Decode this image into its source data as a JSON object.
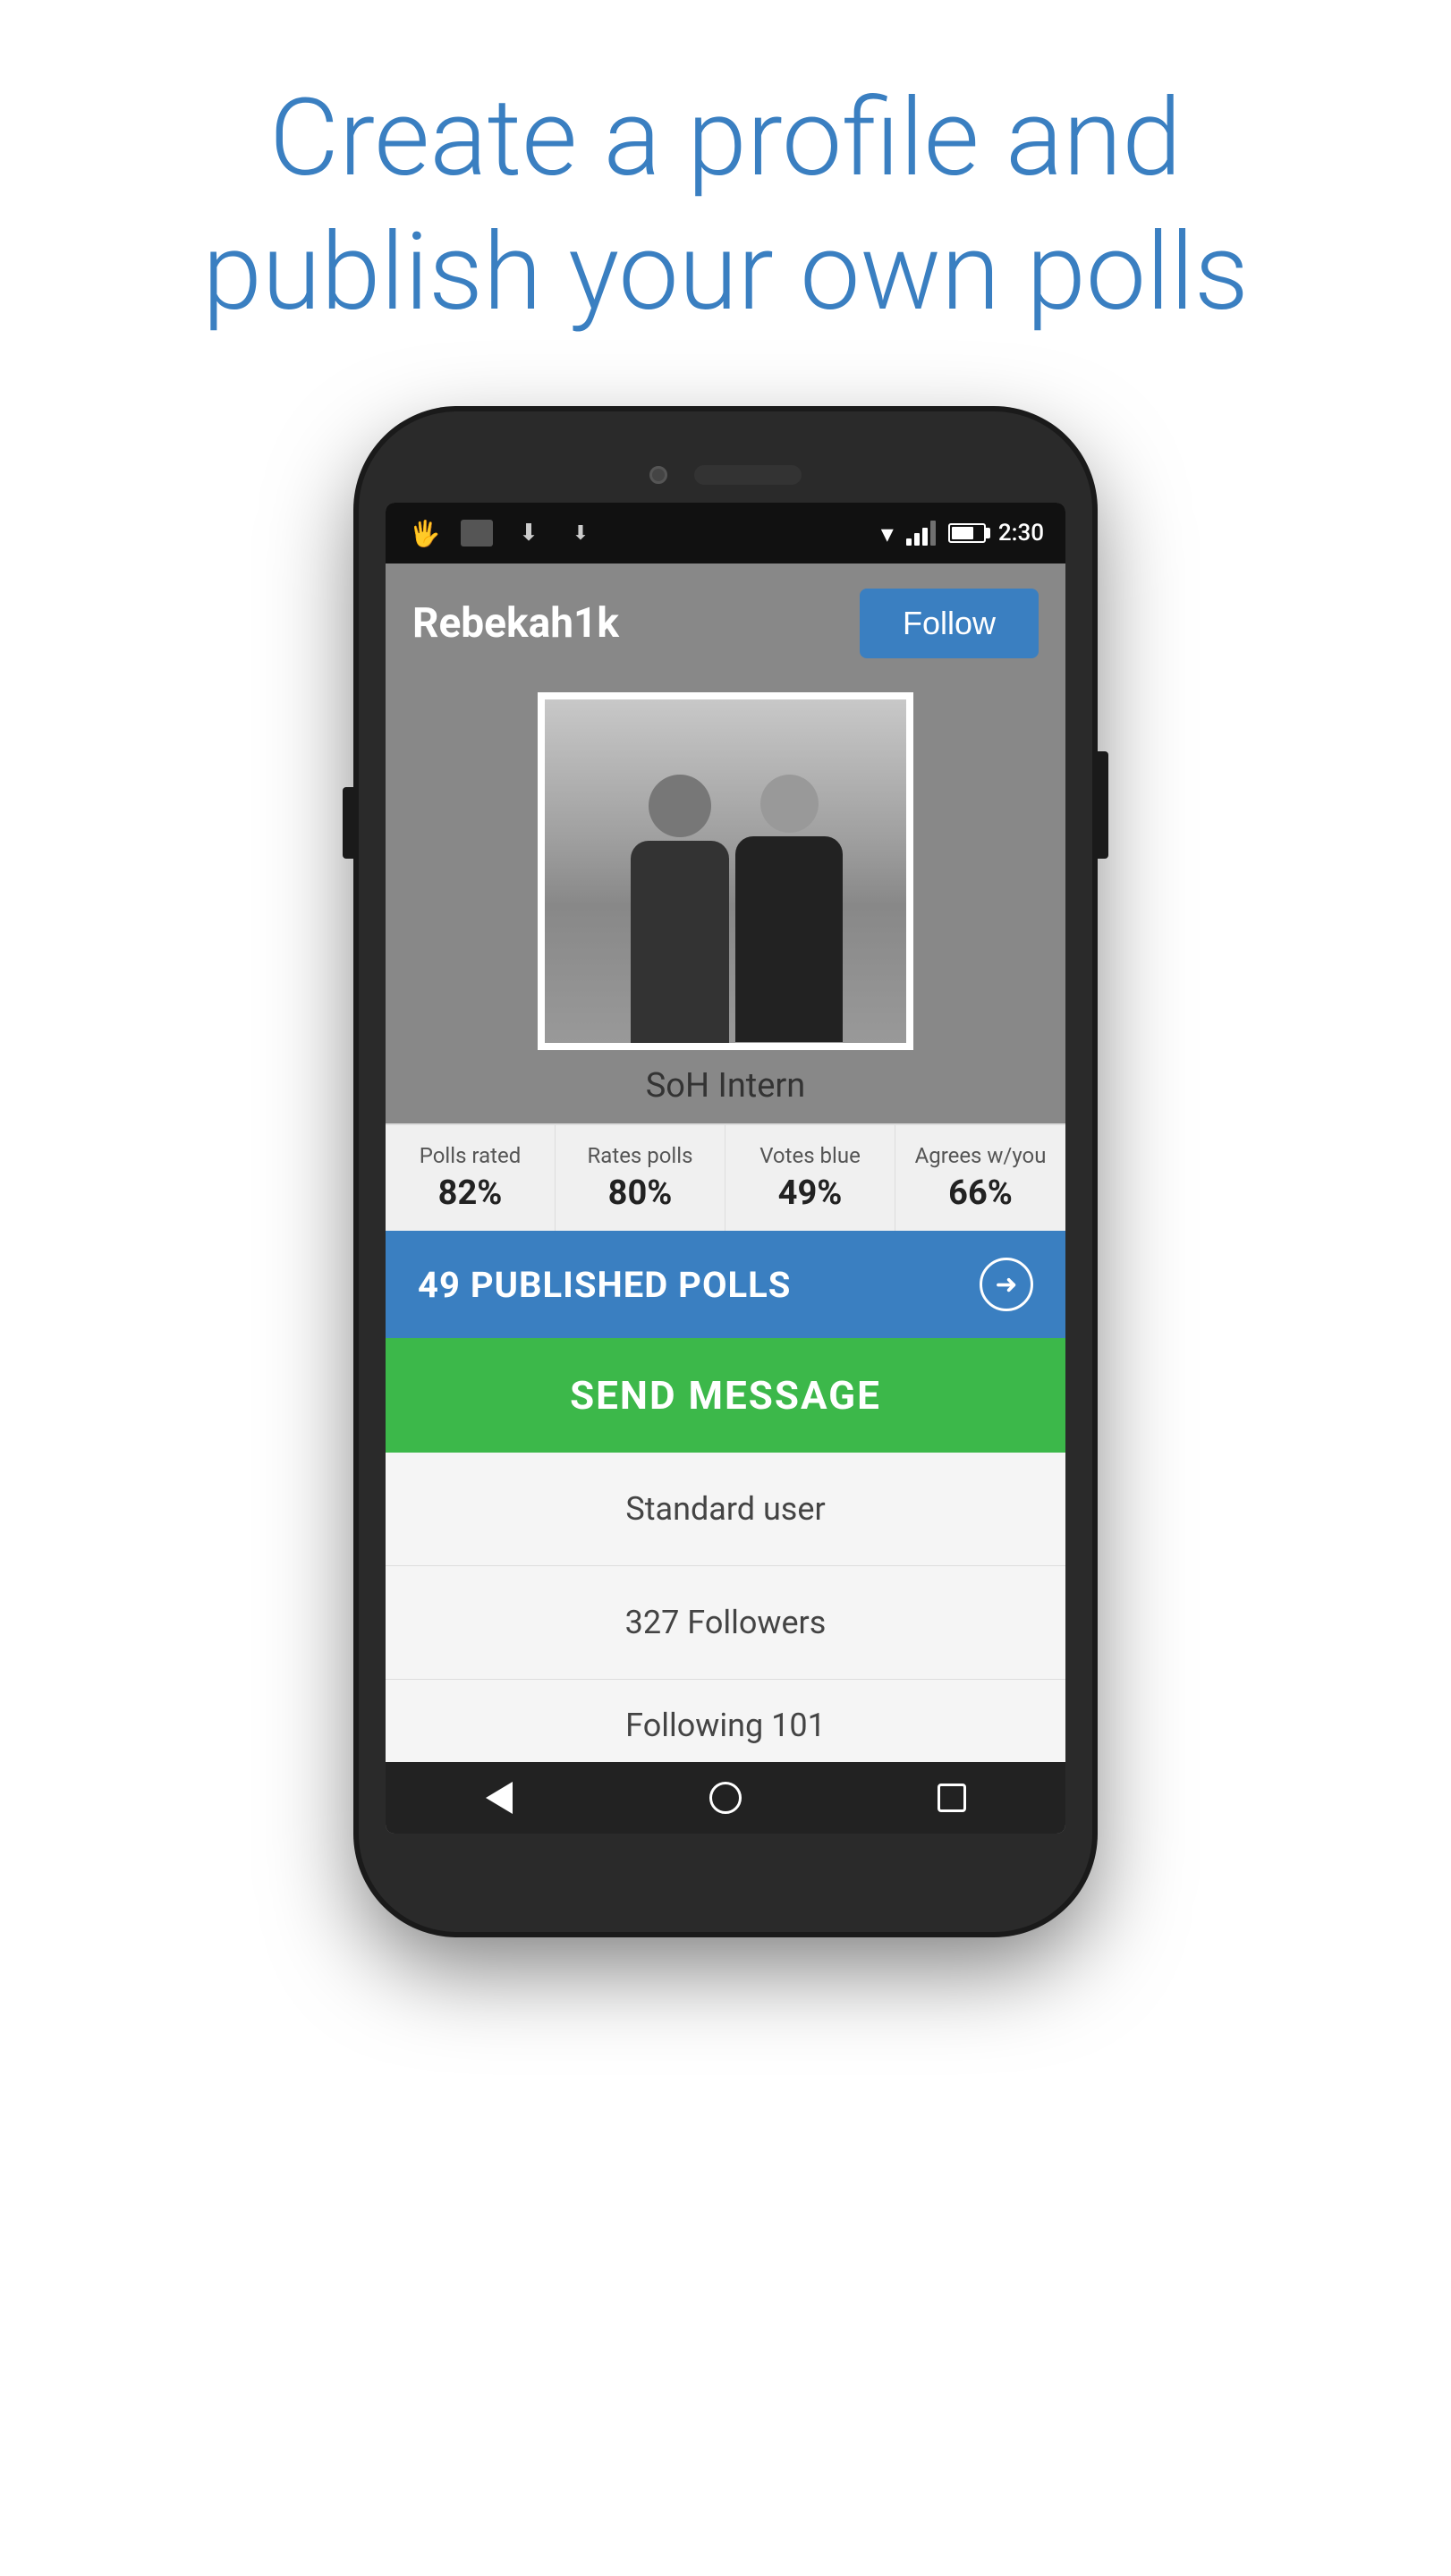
{
  "page": {
    "header": "Create a profile and publish your own polls"
  },
  "statusBar": {
    "time": "2:30",
    "icons": [
      "hand-icon",
      "image-icon",
      "download-icon",
      "download2-icon"
    ]
  },
  "profile": {
    "username": "Rebekah1k",
    "followLabel": "Follow",
    "bio": "SoH Intern",
    "stats": [
      {
        "label": "Polls rated",
        "value": "82%"
      },
      {
        "label": "Rates polls",
        "value": "80%"
      },
      {
        "label": "Votes blue",
        "value": "49%"
      },
      {
        "label": "Agrees w/you",
        "value": "66%"
      }
    ],
    "publishedPolls": "49 PUBLISHED POLLS",
    "sendMessage": "SEND MESSAGE",
    "infoItems": [
      "Standard user",
      "327 Followers",
      "Following 101"
    ]
  },
  "nav": {
    "back": "back-icon",
    "home": "home-icon",
    "recent": "recent-icon"
  }
}
